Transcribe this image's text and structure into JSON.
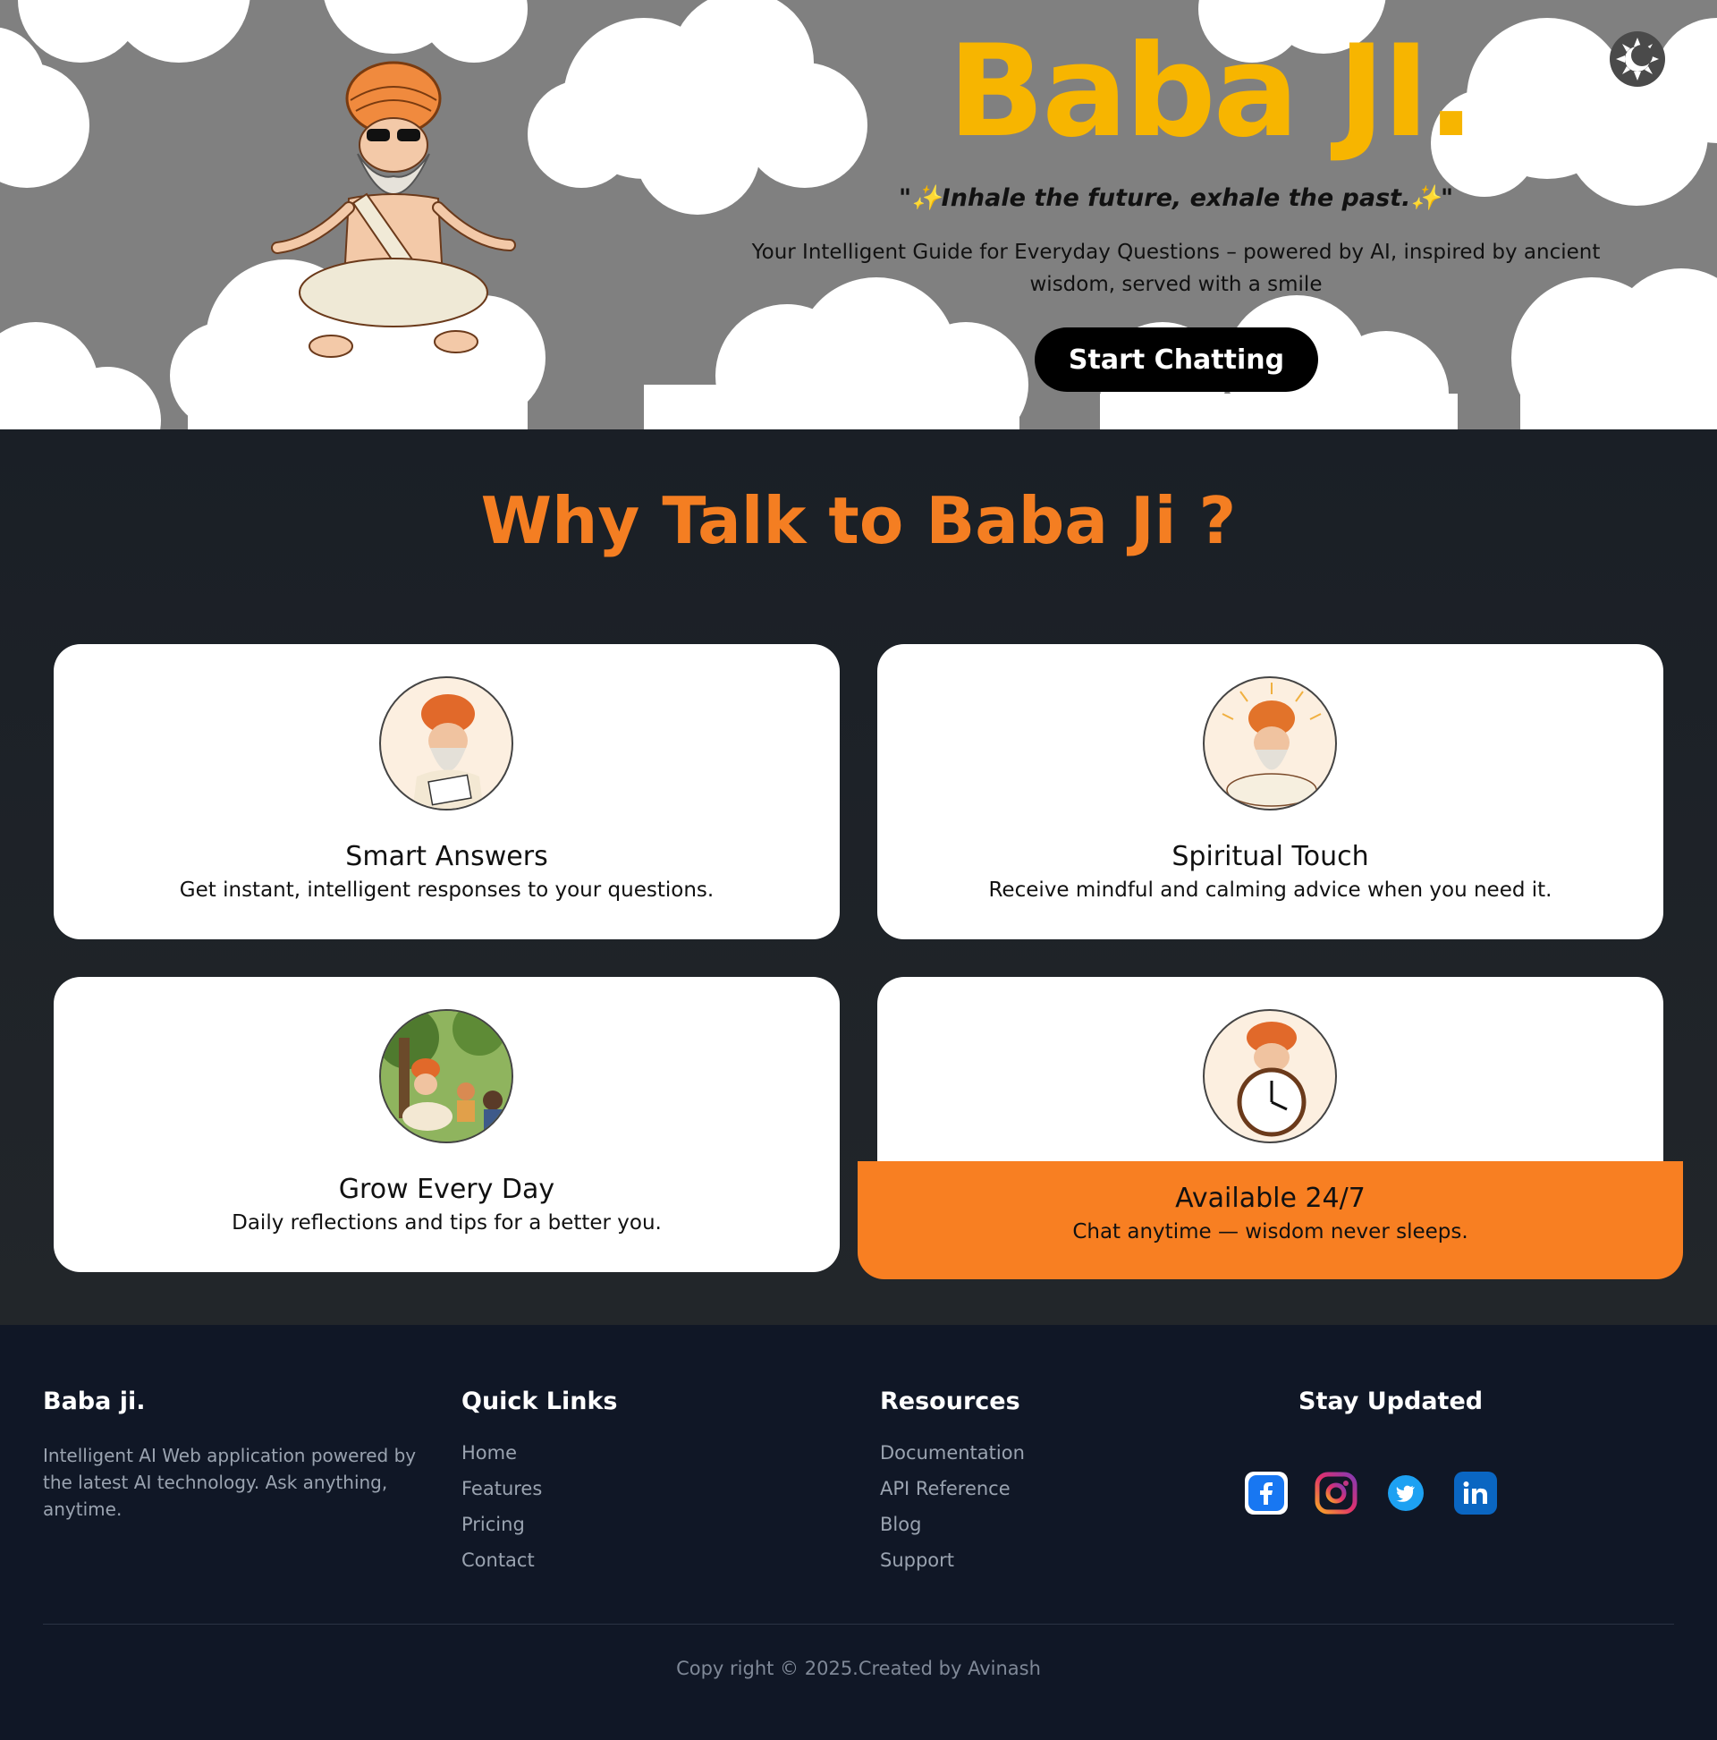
{
  "hero": {
    "brand": "Baba JI.",
    "quote": "\"✨Inhale the future, exhale the past.✨\"",
    "subtitle": "Your Intelligent Guide for Everyday Questions – powered by AI, inspired by ancient wisdom, served with a smile",
    "cta_label": "Start Chatting",
    "theme_toggle_icon": "theme-toggle-icon"
  },
  "features": {
    "title": "Why Talk to Baba Ji ?",
    "cards": [
      {
        "title": "Smart Answers",
        "desc": "Get instant, intelligent responses to your questions.",
        "icon": "baba-writing-icon"
      },
      {
        "title": "Spiritual Touch",
        "desc": "Receive mindful and calming advice when you need it.",
        "icon": "baba-meditating-icon"
      },
      {
        "title": "Grow Every Day",
        "desc": "Daily reflections and tips for a better you.",
        "icon": "baba-teaching-icon"
      },
      {
        "title": "Available 24/7",
        "desc": "Chat anytime — wisdom never sleeps.",
        "icon": "baba-clock-icon"
      }
    ]
  },
  "footer": {
    "brand": "Baba ji.",
    "about": "Intelligent AI Web application powered by the latest AI technology. Ask anything, anytime.",
    "quick_links": {
      "title": "Quick Links",
      "items": [
        "Home",
        "Features",
        "Pricing",
        "Contact"
      ]
    },
    "resources": {
      "title": "Resources",
      "items": [
        "Documentation",
        "API Reference",
        "Blog",
        "Support"
      ]
    },
    "stay_updated": {
      "title": "Stay Updated",
      "social": [
        "facebook-icon",
        "instagram-icon",
        "twitter-icon",
        "linkedin-icon"
      ]
    },
    "copyright": "Copy right © 2025.Created by Avinash"
  },
  "colors": {
    "accent": "#f47e22",
    "brand_yellow": "#f7b500",
    "hero_bg": "#808080",
    "footer_bg": "#101726"
  }
}
